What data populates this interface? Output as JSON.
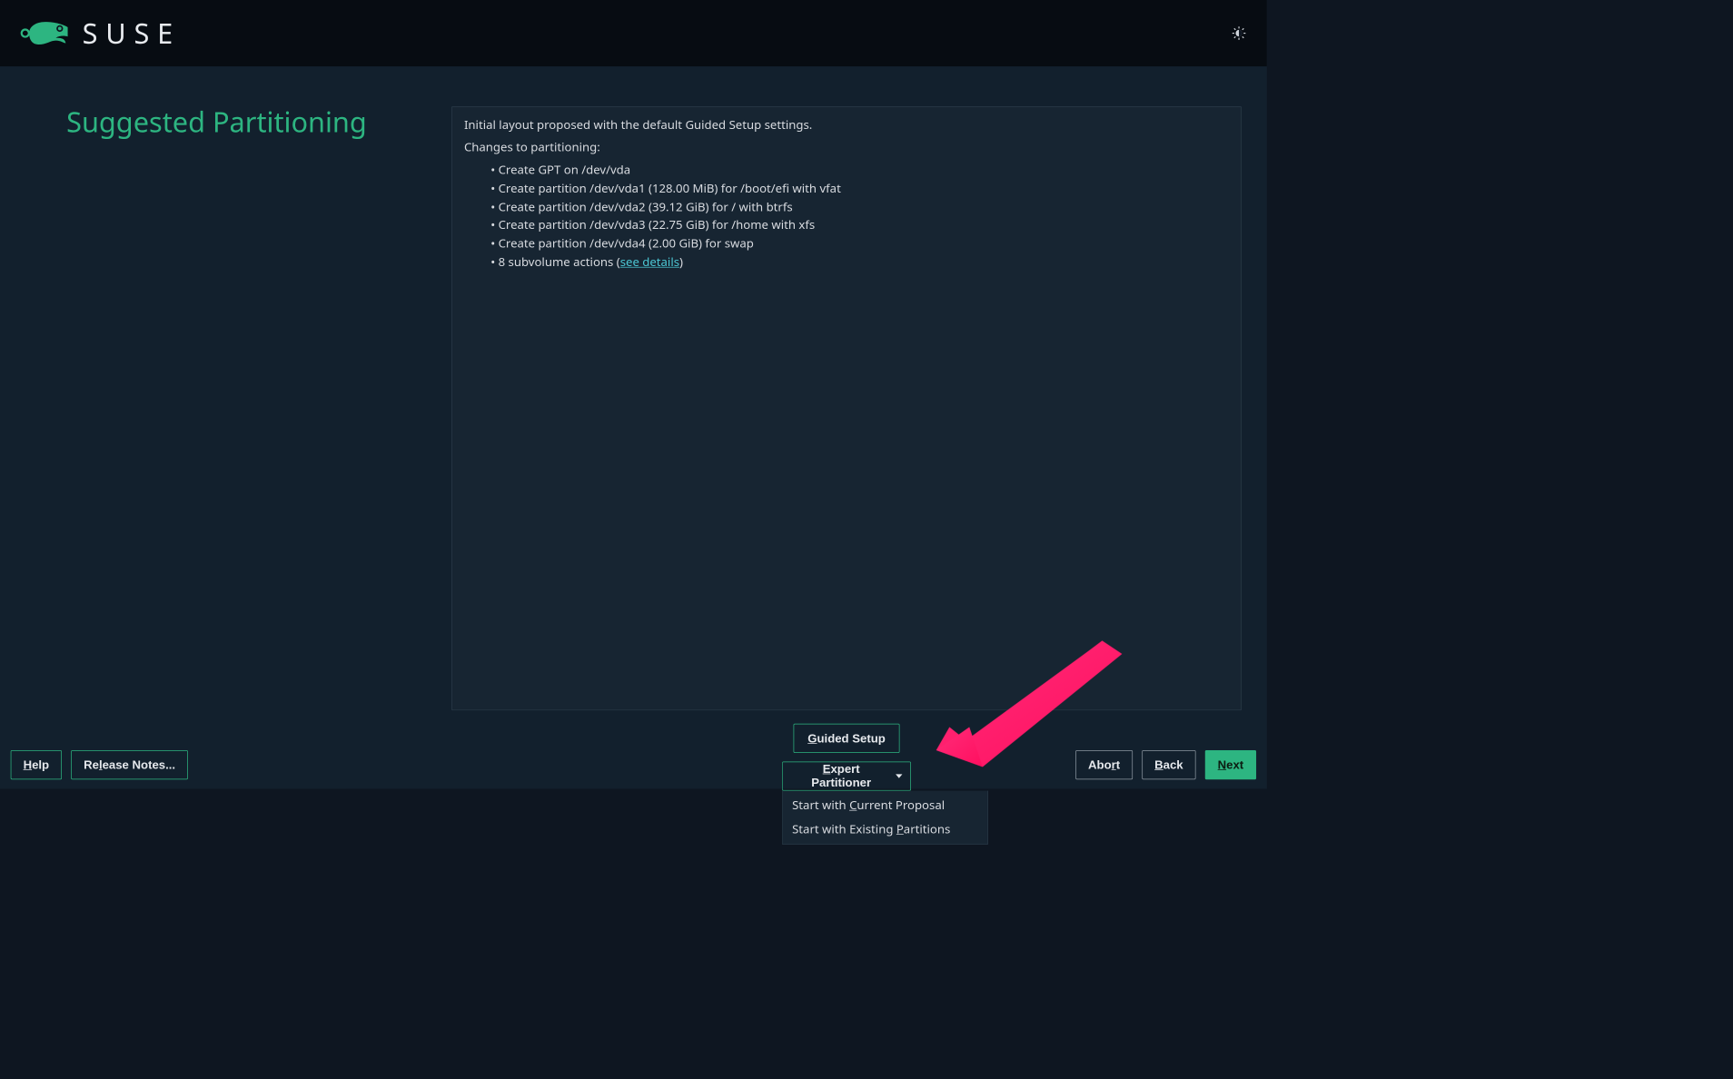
{
  "brand": {
    "name": "SUSE"
  },
  "page": {
    "title": "Suggested Partitioning"
  },
  "panel": {
    "intro": "Initial layout proposed with the default Guided Setup settings.",
    "changes_label": "Changes to partitioning:",
    "items": [
      "Create GPT on /dev/vda",
      "Create partition /dev/vda1 (128.00 MiB) for /boot/efi with vfat",
      "Create partition /dev/vda2 (39.12 GiB) for / with btrfs",
      "Create partition /dev/vda3 (22.75 GiB) for /home with xfs",
      "Create partition /dev/vda4 (2.00 GiB) for swap"
    ],
    "subvolume_prefix": "8 subvolume actions (",
    "subvolume_link": "see details",
    "subvolume_suffix": ")"
  },
  "actions": {
    "guided": "Guided Setup",
    "expert": "Expert Partitioner",
    "dropdown": {
      "current": "Start with Current Proposal",
      "existing": "Start with Existing Partitions"
    }
  },
  "footer": {
    "help": "Help",
    "release_notes": "Release Notes...",
    "abort": "Abort",
    "back": "Back",
    "next": "Next"
  }
}
